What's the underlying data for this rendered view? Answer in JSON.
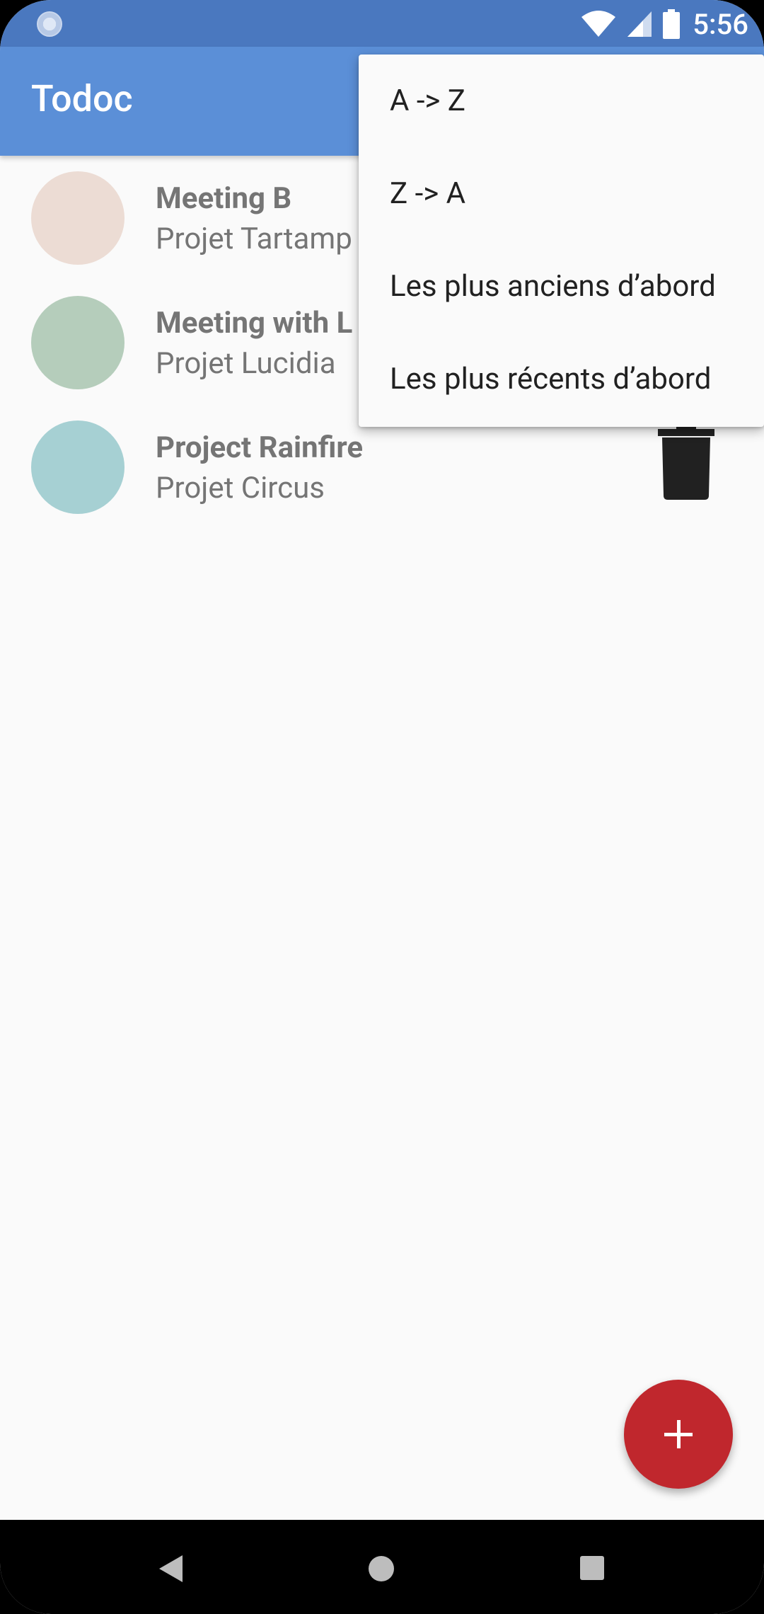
{
  "status_bar": {
    "time": "5:56",
    "icons": [
      "loading-indicator-icon",
      "wifi-icon",
      "cellular-signal-icon",
      "battery-icon"
    ]
  },
  "app_bar": {
    "title": "Todoc"
  },
  "tasks": [
    {
      "name": "Meeting B",
      "project": "Projet Tartamp",
      "color": "#ecdcd4"
    },
    {
      "name": "Meeting with L",
      "project": "Projet Lucidia",
      "color": "#b5cdbb"
    },
    {
      "name": "Project Rainfire",
      "project": "Projet Circus",
      "color": "#a6d0d3"
    }
  ],
  "sort_menu": {
    "items": [
      "A -> Z",
      "Z -> A",
      "Les plus anciens d’abord",
      "Les plus récents d’abord"
    ]
  },
  "fab": {
    "icon": "plus-icon",
    "color": "#c0272d"
  },
  "nav_bar": {
    "icons": [
      "back-icon",
      "home-icon",
      "recents-icon"
    ]
  },
  "colors": {
    "status_bar": "#4a78bf",
    "app_bar": "#5b8fd7",
    "background": "#fafafa"
  }
}
